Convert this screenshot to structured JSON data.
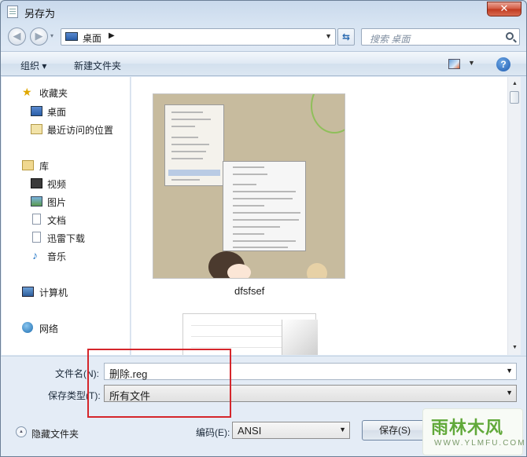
{
  "window": {
    "title": "另存为",
    "close_label": "✕"
  },
  "nav": {
    "back": "◀",
    "forward": "▶",
    "dropdown": "▾"
  },
  "address": {
    "location": "桌面",
    "arrow": "▶"
  },
  "search": {
    "placeholder": "搜索 桌面"
  },
  "toolbar": {
    "organize": "组织 ▾",
    "new_folder": "新建文件夹",
    "help": "?"
  },
  "sidebar": {
    "favorites": {
      "label": "收藏夹",
      "items": [
        "桌面",
        "最近访问的位置"
      ]
    },
    "libraries": {
      "label": "库",
      "items": [
        "视频",
        "图片",
        "文档",
        "迅雷下载",
        "音乐"
      ]
    },
    "computer": "计算机",
    "network": "网络"
  },
  "files": [
    {
      "name": "dfsfsef",
      "type": "image"
    },
    {
      "name": "",
      "type": "document"
    }
  ],
  "form": {
    "filename_label": "文件名(N):",
    "filename_value": "删除.reg",
    "filetype_label": "保存类型(T):",
    "filetype_value": "所有文件",
    "encoding_label": "编码(E):",
    "encoding_value": "ANSI"
  },
  "footer": {
    "hide_folders": "隐藏文件夹",
    "save": "保存(S)"
  },
  "watermark": {
    "title": "雨林木风",
    "subtitle": "WWW.YLMFU.COM"
  },
  "colors": {
    "highlight_box": "#d5262b",
    "close_button": "#c0391f"
  }
}
